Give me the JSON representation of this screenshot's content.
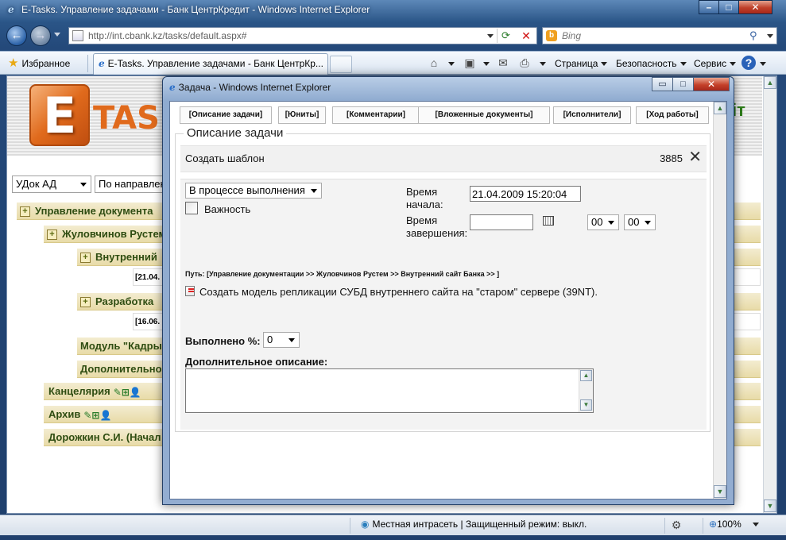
{
  "browser": {
    "title": "E-Tasks. Управление задачами - Банк ЦентрКредит - Windows Internet Explorer",
    "address": "http://int.cbank.kz/tasks/default.aspx#",
    "search_placeholder": "Bing",
    "favorites": "Избранное",
    "tab_title": "E-Tasks. Управление задачами - Банк ЦентрКр...",
    "commands": {
      "page": "Страница",
      "security": "Безопасность",
      "service": "Сервис"
    }
  },
  "page": {
    "logo_letter": "E",
    "logo_text": "TASK",
    "right_logo_fragment": "іт",
    "selects": [
      "УДок АД",
      "По направлен"
    ],
    "tree": [
      {
        "label": "Управление документа"
      },
      {
        "label": "Жуловчинов Рустем"
      },
      {
        "label": "Внутренний"
      },
      {
        "label": "Разработка"
      },
      {
        "label": "Модуль \"Кадры"
      },
      {
        "label": "Дополнительно"
      },
      {
        "label": "Канцелярия"
      },
      {
        "label": "Архив"
      },
      {
        "label": "Дорожкин С.И. (Начал"
      }
    ],
    "dates": [
      "[21.04.",
      "[16.06."
    ]
  },
  "popup": {
    "title": "Задача - Windows Internet Explorer",
    "tabs": [
      "[Описание задачи]",
      "[Юниты]",
      "[Комментарии]",
      "[Вложенные документы]",
      "[Исполнители]",
      "[Ход работы]"
    ],
    "legend": "Описание задачи",
    "task_name": "Создать шаблон",
    "task_number": "3885",
    "status_value": "В процессе выполнения",
    "importance_label": "Важность",
    "start_label_1": "Время",
    "start_label_2": "начала:",
    "start_value": "21.04.2009 15:20:04",
    "end_label_1": "Время",
    "end_label_2": "завершения:",
    "end_value": "",
    "hour_value": "00",
    "minute_value": "00",
    "path": "Путь: [Управление документации >> Жуловчинов Рустем >> Внутренний сайт Банка >> ]",
    "task_description": "Создать модель репликации СУБД внутреннего сайта на \"старом\" сервере (39NT).",
    "done_label": "Выполнено %:",
    "done_value": "0",
    "extra_desc_label": "Дополнительное описание:"
  },
  "status": {
    "zone": "Местная интрасеть | Защищенный режим: выкл.",
    "zoom": "100%"
  }
}
